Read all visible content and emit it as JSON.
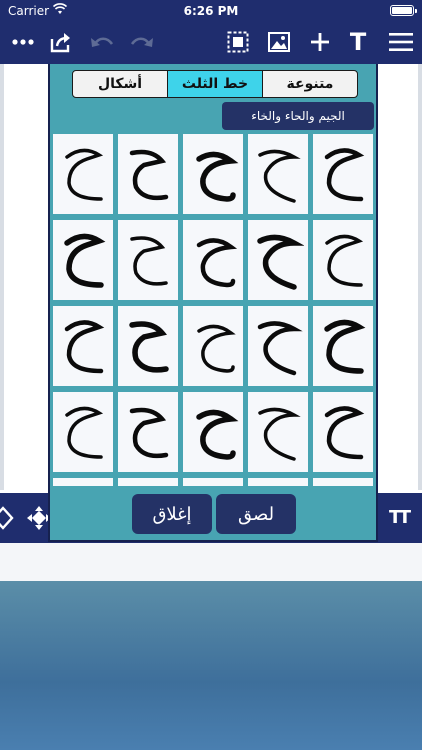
{
  "status": {
    "carrier": "Carrier",
    "time": "6:26 PM"
  },
  "toolbar": {
    "icons": [
      "more-icon",
      "share-icon",
      "undo-icon",
      "redo-icon",
      "select-frame-icon",
      "image-icon",
      "add-icon",
      "text-icon",
      "menu-icon"
    ],
    "text_glyph": "T"
  },
  "panel": {
    "tabs": [
      {
        "label": "أشكال",
        "active": false
      },
      {
        "label": "خط الثلث",
        "active": true
      },
      {
        "label": "متنوعة",
        "active": false
      }
    ],
    "category": "الجيم والحاء والخاء",
    "glyph_count": 25,
    "buttons": {
      "paste": "لصق",
      "close": "إغلاق"
    }
  },
  "bottom_strip": {
    "left_icons": [
      "diamond-icon",
      "move-arrows-icon"
    ],
    "right_icon": "text-size-icon",
    "text_size_label": "TT"
  },
  "colors": {
    "nav": "#1f2d6e",
    "panel": "#48a4b2",
    "active_tab": "#3ed3ea",
    "chip": "#243266"
  }
}
